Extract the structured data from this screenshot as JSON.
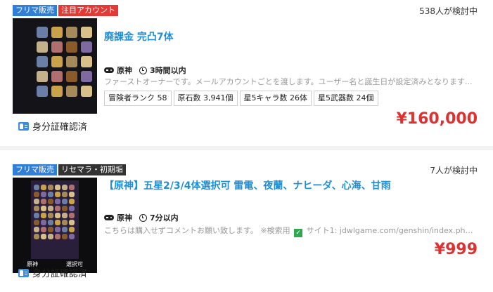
{
  "colors": {
    "primary_badge": "#2f7ed8",
    "hot_badge": "#e53935",
    "dark_badge": "#333333",
    "title": "#1e8fd6",
    "price": "#e03131"
  },
  "listings": [
    {
      "badges": [
        {
          "label": "フリマ販売",
          "color": "#2f7ed8"
        },
        {
          "label": "注目アカウント",
          "color": "#e53935"
        }
      ],
      "viewers": "538人が検討中",
      "title": "廃課金 完凸7体",
      "game": "原神",
      "time": "3時間以内",
      "description": "ファーストオーナーです。メールアカウントごとを渡します。ユーザー名と誕生日が設定済みとなります...",
      "tags": [
        "冒険者ランク 58",
        "原石数 3,941個",
        "星5キャラ数 26体",
        "星5武器数 24個"
      ],
      "price": "¥160,000",
      "verification": "身分証確認済",
      "icons": [
        "gamepad-icon",
        "clock-icon",
        "id-card-icon"
      ]
    },
    {
      "badges": [
        {
          "label": "フリマ販売",
          "color": "#2f7ed8"
        },
        {
          "label": "リセマラ・初期垢",
          "color": "#333333"
        }
      ],
      "viewers": "7人が検討中",
      "title": "【原神】五星2/3/4体選択可 雷電、夜蘭、ナヒーダ、心海、甘雨",
      "game": "原神",
      "time": "7分以内",
      "description_before": "こちらは購入せずコメントお願い致します。 ※検索用",
      "description_after": "サイト1: jdwlgame.com/genshin/index.php 検...",
      "price": "¥999",
      "verification": "身分証確認済",
      "thumbnail_labels": [
        "原神",
        "選択可"
      ],
      "icons": [
        "gamepad-icon",
        "clock-icon",
        "check-icon",
        "id-card-icon"
      ]
    }
  ]
}
